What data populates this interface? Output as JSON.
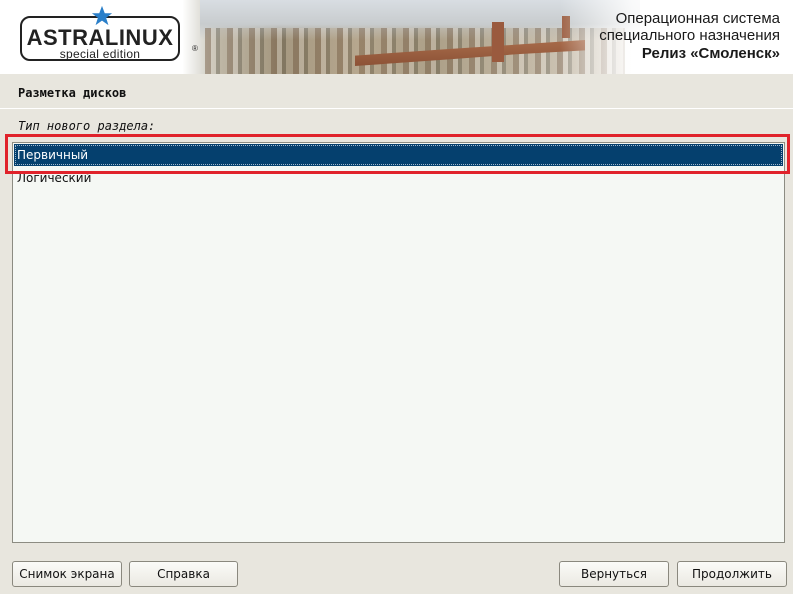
{
  "header": {
    "logo_main": "ASTRALINUX",
    "logo_sub": "special edition",
    "logo_reg": "®",
    "os_line1": "Операционная система",
    "os_line2": "специального назначения",
    "os_line3": "Релиз «Смоленск»"
  },
  "page": {
    "title": "Разметка дисков",
    "question": "Тип нового раздела:"
  },
  "options": [
    {
      "label": "Первичный",
      "selected": true
    },
    {
      "label": "Логический",
      "selected": false
    }
  ],
  "buttons": {
    "screenshot": "Снимок экрана",
    "help": "Справка",
    "back": "Вернуться",
    "continue": "Продолжить"
  },
  "colors": {
    "selection": "#05406e",
    "highlight_box": "#e0232b",
    "logo_star": "#2a7fc9"
  },
  "icons": {
    "logo_star": "star-icon"
  }
}
